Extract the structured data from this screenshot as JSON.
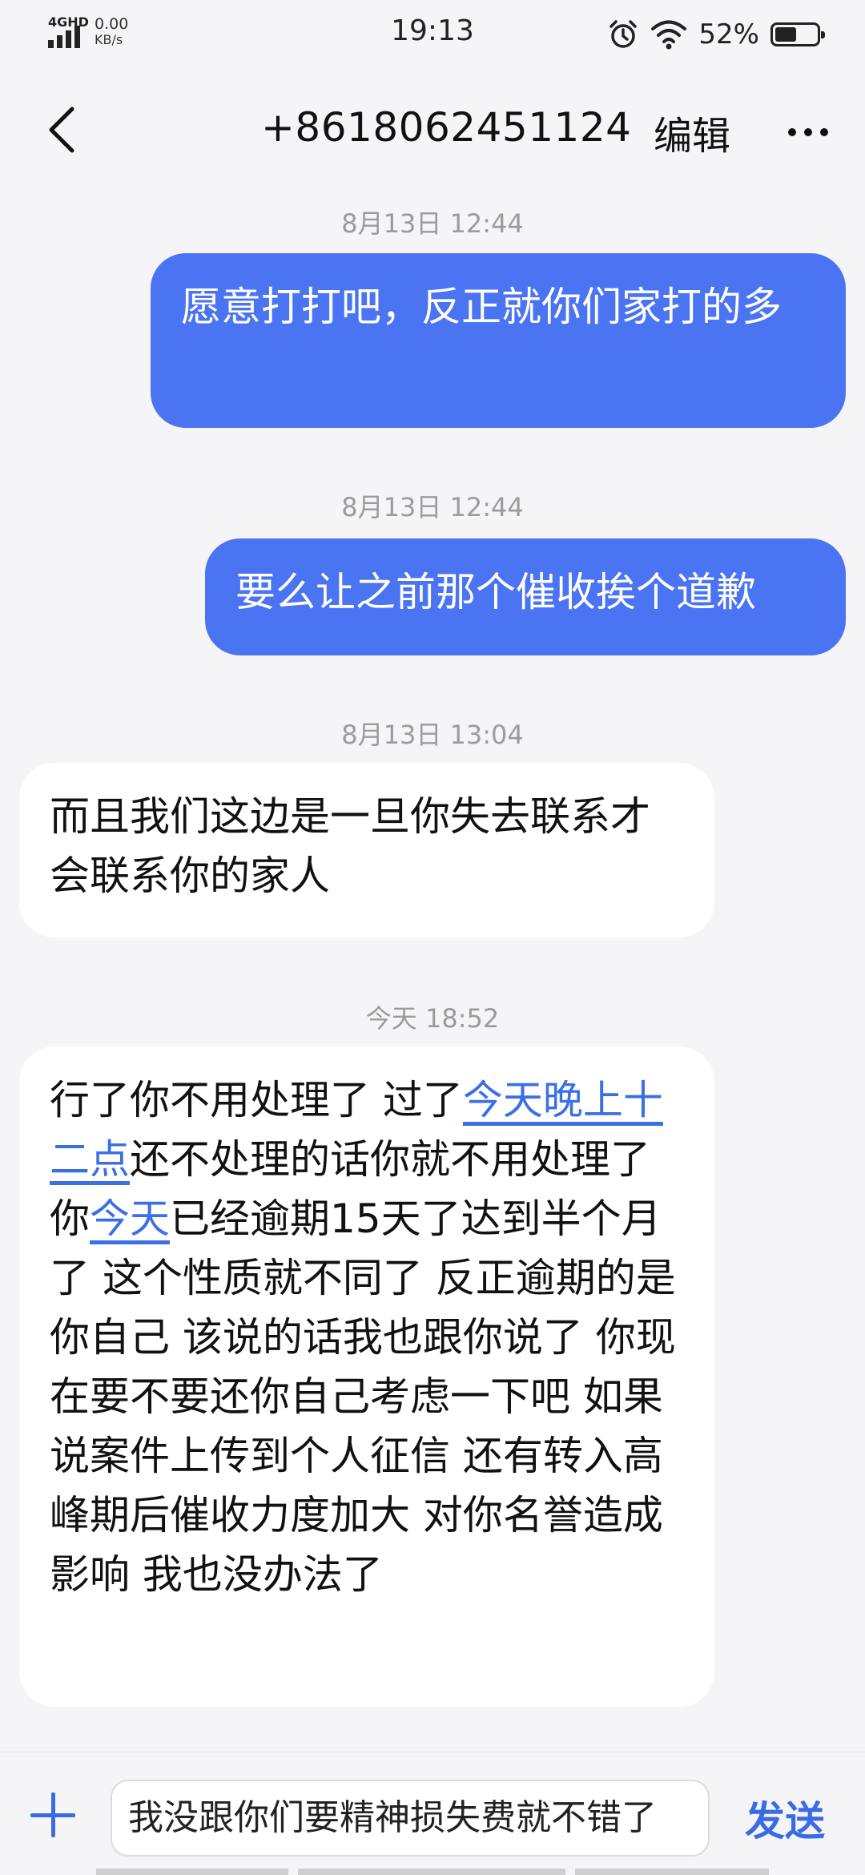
{
  "status_bar": {
    "network": "4GHD",
    "speed_value": "0.00",
    "speed_unit": "KB/s",
    "time": "19:13",
    "battery_percent": "52%",
    "battery_level": 0.52,
    "icons": [
      "signal-icon",
      "alarm-icon",
      "wifi-icon",
      "battery-icon"
    ]
  },
  "header": {
    "back_icon": "chevron-left-icon",
    "contact": "+8618062451124",
    "edit_label": "编辑",
    "more_icon": "more-dots-icon"
  },
  "messages": [
    {
      "timestamp": "8月13日 12:44",
      "direction": "out",
      "text": "愿意打打吧，反正就你们家打的多"
    },
    {
      "timestamp": "8月13日 12:44",
      "direction": "out",
      "text": "要么让之前那个催收挨个道歉"
    },
    {
      "timestamp": "8月13日 13:04",
      "direction": "in",
      "text": "而且我们这边是一旦你失去联系才会联系你的家人"
    },
    {
      "timestamp": "今天 18:52",
      "direction": "in",
      "parts": [
        {
          "text": "行了你不用处理了 过了"
        },
        {
          "text": "今天晚上十二点",
          "link": true
        },
        {
          "text": "还不处理的话你就不用处理了 你"
        },
        {
          "text": "今天",
          "link": true
        },
        {
          "text": "已经逾期15天了达到半个月了 这个性质就不同了 反正逾期的是你自己 该说的话我也跟你说了 你现在要不要还你自己考虑一下吧 如果说案件上传到个人征信 还有转入高峰期后催收力度加大 对你名誉造成影响 我也没办法了"
        }
      ]
    }
  ],
  "compose": {
    "add_icon": "plus-icon",
    "input_value": "我没跟你们要精神损失费就不错了",
    "send_label": "发送"
  },
  "colors": {
    "outgoing_bubble": "#4b74f3",
    "incoming_bubble": "#ffffff",
    "link": "#3b6fe4",
    "accent": "#3a6be6",
    "background": "#f5f5f7",
    "timestamp": "#9b9b9b"
  }
}
